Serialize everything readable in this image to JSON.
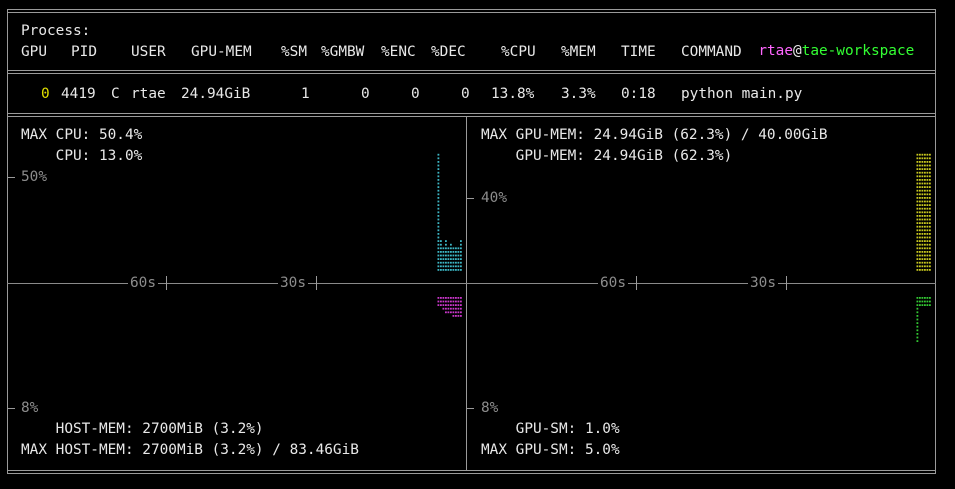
{
  "header": {
    "title": "Process:",
    "user": "rtae",
    "at": "@",
    "host": "tae-workspace",
    "columns": [
      "GPU",
      "PID",
      "USER",
      "GPU-MEM",
      "%SM",
      "%GMBW",
      "%ENC",
      "%DEC",
      "%CPU",
      "%MEM",
      "TIME",
      "COMMAND"
    ]
  },
  "process": {
    "gpu": "0",
    "pid": "4419",
    "type": "C",
    "user": "rtae",
    "gpu_mem": "24.94GiB",
    "sm": "1",
    "gmbw": "0",
    "enc": "0",
    "dec": "0",
    "cpu": "13.8%",
    "mem": "3.3%",
    "time": "0:18",
    "command": "python main.py"
  },
  "left_panel": {
    "max_cpu": "MAX CPU: 50.4%",
    "cpu": "    CPU: 13.0%",
    "y_top": "50%",
    "y_bottom": "8%",
    "tick_60": "60s",
    "tick_30": "30s",
    "host_mem": "    HOST-MEM: 2700MiB (3.2%)",
    "max_host_mem": "MAX HOST-MEM: 2700MiB (3.2%) / 83.46GiB"
  },
  "right_panel": {
    "max_gpu_mem": "MAX GPU-MEM: 24.94GiB (62.3%) / 40.00GiB",
    "gpu_mem": "    GPU-MEM: 24.94GiB (62.3%)",
    "y_top": "40%",
    "y_bottom": "8%",
    "tick_60": "60s",
    "tick_30": "30s",
    "gpu_sm": "    GPU-SM: 1.0%",
    "max_gpu_sm": "MAX GPU-SM: 5.0%"
  },
  "colors": {
    "cpu": "#3cb6c4",
    "host_mem": "#c936c9",
    "gpu_mem": "#c8c81e",
    "gpu_sm": "#33c833"
  },
  "chart_data": [
    {
      "type": "area",
      "series": [
        {
          "name": "CPU",
          "values": [
            0,
            0,
            0,
            0,
            0,
            0,
            0,
            0,
            0,
            0,
            0,
            0,
            0,
            0,
            0,
            0,
            0,
            0,
            0,
            0,
            0,
            0,
            0,
            0,
            0,
            0,
            0,
            0,
            0,
            0,
            50.4,
            13.0,
            10.0,
            13.0,
            11.0,
            12.0,
            10.0,
            11.0,
            11.0,
            13.0
          ]
        }
      ],
      "ylim": [
        0,
        50
      ]
    },
    {
      "type": "area",
      "series": [
        {
          "name": "HOST-MEM",
          "values": [
            0,
            0,
            0,
            0,
            0,
            0,
            0,
            0,
            0,
            0,
            0,
            0,
            0,
            0,
            0,
            0,
            0,
            0,
            0,
            0,
            0,
            0,
            0,
            0,
            0,
            0,
            0,
            0,
            0,
            0,
            1.5,
            1.6,
            2.2,
            2.7,
            3.0,
            3.1,
            3.2,
            3.2,
            3.2,
            3.2
          ]
        }
      ],
      "ylim": [
        0,
        8
      ]
    },
    {
      "type": "area",
      "series": [
        {
          "name": "GPU-MEM",
          "values": [
            0,
            0,
            0,
            0,
            0,
            0,
            0,
            0,
            0,
            0,
            0,
            0,
            0,
            0,
            0,
            0,
            0,
            0,
            0,
            0,
            0,
            0,
            0,
            0,
            0,
            0,
            0,
            0,
            0,
            0,
            0,
            0,
            0,
            0,
            62.3,
            62.3,
            62.3,
            62.3,
            62.3,
            62.3
          ]
        }
      ],
      "ylim": [
        0,
        40
      ]
    },
    {
      "type": "area",
      "series": [
        {
          "name": "GPU-SM",
          "values": [
            0,
            0,
            0,
            0,
            0,
            0,
            0,
            0,
            0,
            0,
            0,
            0,
            0,
            0,
            0,
            0,
            0,
            0,
            0,
            0,
            0,
            0,
            0,
            0,
            0,
            0,
            0,
            0,
            0,
            0,
            0,
            0,
            0,
            0,
            5.0,
            1.0,
            1.0,
            1.0,
            1.0,
            1.0
          ]
        }
      ],
      "ylim": [
        0,
        8
      ]
    }
  ]
}
